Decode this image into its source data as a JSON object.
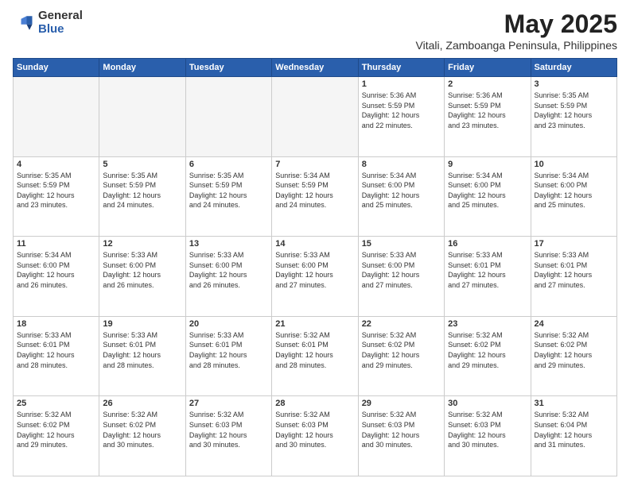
{
  "logo": {
    "general": "General",
    "blue": "Blue"
  },
  "title": {
    "month": "May 2025",
    "location": "Vitali, Zamboanga Peninsula, Philippines"
  },
  "weekdays": [
    "Sunday",
    "Monday",
    "Tuesday",
    "Wednesday",
    "Thursday",
    "Friday",
    "Saturday"
  ],
  "weeks": [
    [
      {
        "day": "",
        "info": ""
      },
      {
        "day": "",
        "info": ""
      },
      {
        "day": "",
        "info": ""
      },
      {
        "day": "",
        "info": ""
      },
      {
        "day": "1",
        "info": "Sunrise: 5:36 AM\nSunset: 5:59 PM\nDaylight: 12 hours\nand 22 minutes."
      },
      {
        "day": "2",
        "info": "Sunrise: 5:36 AM\nSunset: 5:59 PM\nDaylight: 12 hours\nand 23 minutes."
      },
      {
        "day": "3",
        "info": "Sunrise: 5:35 AM\nSunset: 5:59 PM\nDaylight: 12 hours\nand 23 minutes."
      }
    ],
    [
      {
        "day": "4",
        "info": "Sunrise: 5:35 AM\nSunset: 5:59 PM\nDaylight: 12 hours\nand 23 minutes."
      },
      {
        "day": "5",
        "info": "Sunrise: 5:35 AM\nSunset: 5:59 PM\nDaylight: 12 hours\nand 24 minutes."
      },
      {
        "day": "6",
        "info": "Sunrise: 5:35 AM\nSunset: 5:59 PM\nDaylight: 12 hours\nand 24 minutes."
      },
      {
        "day": "7",
        "info": "Sunrise: 5:34 AM\nSunset: 5:59 PM\nDaylight: 12 hours\nand 24 minutes."
      },
      {
        "day": "8",
        "info": "Sunrise: 5:34 AM\nSunset: 6:00 PM\nDaylight: 12 hours\nand 25 minutes."
      },
      {
        "day": "9",
        "info": "Sunrise: 5:34 AM\nSunset: 6:00 PM\nDaylight: 12 hours\nand 25 minutes."
      },
      {
        "day": "10",
        "info": "Sunrise: 5:34 AM\nSunset: 6:00 PM\nDaylight: 12 hours\nand 25 minutes."
      }
    ],
    [
      {
        "day": "11",
        "info": "Sunrise: 5:34 AM\nSunset: 6:00 PM\nDaylight: 12 hours\nand 26 minutes."
      },
      {
        "day": "12",
        "info": "Sunrise: 5:33 AM\nSunset: 6:00 PM\nDaylight: 12 hours\nand 26 minutes."
      },
      {
        "day": "13",
        "info": "Sunrise: 5:33 AM\nSunset: 6:00 PM\nDaylight: 12 hours\nand 26 minutes."
      },
      {
        "day": "14",
        "info": "Sunrise: 5:33 AM\nSunset: 6:00 PM\nDaylight: 12 hours\nand 27 minutes."
      },
      {
        "day": "15",
        "info": "Sunrise: 5:33 AM\nSunset: 6:00 PM\nDaylight: 12 hours\nand 27 minutes."
      },
      {
        "day": "16",
        "info": "Sunrise: 5:33 AM\nSunset: 6:01 PM\nDaylight: 12 hours\nand 27 minutes."
      },
      {
        "day": "17",
        "info": "Sunrise: 5:33 AM\nSunset: 6:01 PM\nDaylight: 12 hours\nand 27 minutes."
      }
    ],
    [
      {
        "day": "18",
        "info": "Sunrise: 5:33 AM\nSunset: 6:01 PM\nDaylight: 12 hours\nand 28 minutes."
      },
      {
        "day": "19",
        "info": "Sunrise: 5:33 AM\nSunset: 6:01 PM\nDaylight: 12 hours\nand 28 minutes."
      },
      {
        "day": "20",
        "info": "Sunrise: 5:33 AM\nSunset: 6:01 PM\nDaylight: 12 hours\nand 28 minutes."
      },
      {
        "day": "21",
        "info": "Sunrise: 5:32 AM\nSunset: 6:01 PM\nDaylight: 12 hours\nand 28 minutes."
      },
      {
        "day": "22",
        "info": "Sunrise: 5:32 AM\nSunset: 6:02 PM\nDaylight: 12 hours\nand 29 minutes."
      },
      {
        "day": "23",
        "info": "Sunrise: 5:32 AM\nSunset: 6:02 PM\nDaylight: 12 hours\nand 29 minutes."
      },
      {
        "day": "24",
        "info": "Sunrise: 5:32 AM\nSunset: 6:02 PM\nDaylight: 12 hours\nand 29 minutes."
      }
    ],
    [
      {
        "day": "25",
        "info": "Sunrise: 5:32 AM\nSunset: 6:02 PM\nDaylight: 12 hours\nand 29 minutes."
      },
      {
        "day": "26",
        "info": "Sunrise: 5:32 AM\nSunset: 6:02 PM\nDaylight: 12 hours\nand 30 minutes."
      },
      {
        "day": "27",
        "info": "Sunrise: 5:32 AM\nSunset: 6:03 PM\nDaylight: 12 hours\nand 30 minutes."
      },
      {
        "day": "28",
        "info": "Sunrise: 5:32 AM\nSunset: 6:03 PM\nDaylight: 12 hours\nand 30 minutes."
      },
      {
        "day": "29",
        "info": "Sunrise: 5:32 AM\nSunset: 6:03 PM\nDaylight: 12 hours\nand 30 minutes."
      },
      {
        "day": "30",
        "info": "Sunrise: 5:32 AM\nSunset: 6:03 PM\nDaylight: 12 hours\nand 30 minutes."
      },
      {
        "day": "31",
        "info": "Sunrise: 5:32 AM\nSunset: 6:04 PM\nDaylight: 12 hours\nand 31 minutes."
      }
    ]
  ]
}
